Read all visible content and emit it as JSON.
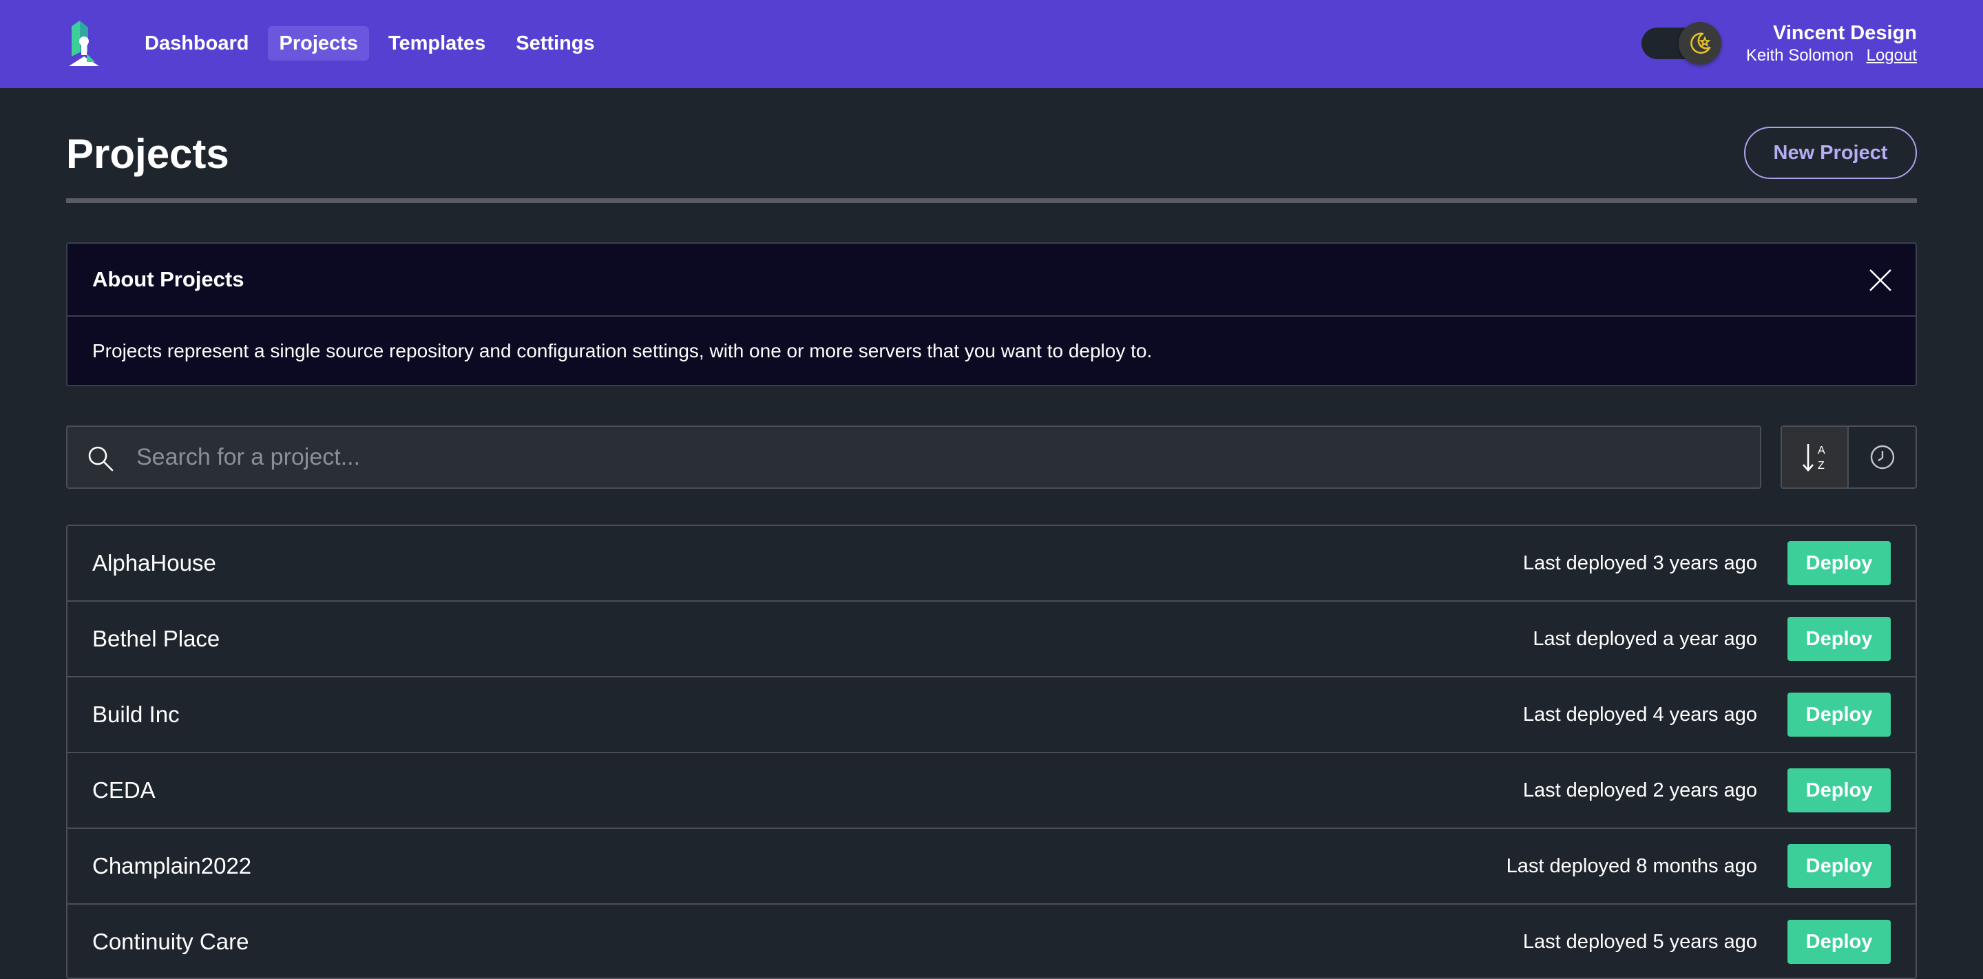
{
  "header": {
    "nav": [
      "Dashboard",
      "Projects",
      "Templates",
      "Settings"
    ],
    "active_nav": "Projects",
    "org_name": "Vincent Design",
    "user_name": "Keith Solomon",
    "logout_label": "Logout",
    "accent_color": "#5640d2"
  },
  "page": {
    "title": "Projects",
    "new_project_label": "New Project"
  },
  "about": {
    "title": "About Projects",
    "body": "Projects represent a single source repository and configuration settings, with one or more servers that you want to deploy to."
  },
  "search": {
    "placeholder": "Search for a project...",
    "value": ""
  },
  "sort": {
    "active": "alphabetical"
  },
  "projects": [
    {
      "name": "AlphaHouse",
      "deployed": "Last deployed 3 years ago",
      "action": "Deploy"
    },
    {
      "name": "Bethel Place",
      "deployed": "Last deployed a year ago",
      "action": "Deploy"
    },
    {
      "name": "Build Inc",
      "deployed": "Last deployed 4 years ago",
      "action": "Deploy"
    },
    {
      "name": "CEDA",
      "deployed": "Last deployed 2 years ago",
      "action": "Deploy"
    },
    {
      "name": "Champlain2022",
      "deployed": "Last deployed 8 months ago",
      "action": "Deploy"
    },
    {
      "name": "Continuity Care",
      "deployed": "Last deployed 5 years ago",
      "action": "Deploy"
    }
  ]
}
